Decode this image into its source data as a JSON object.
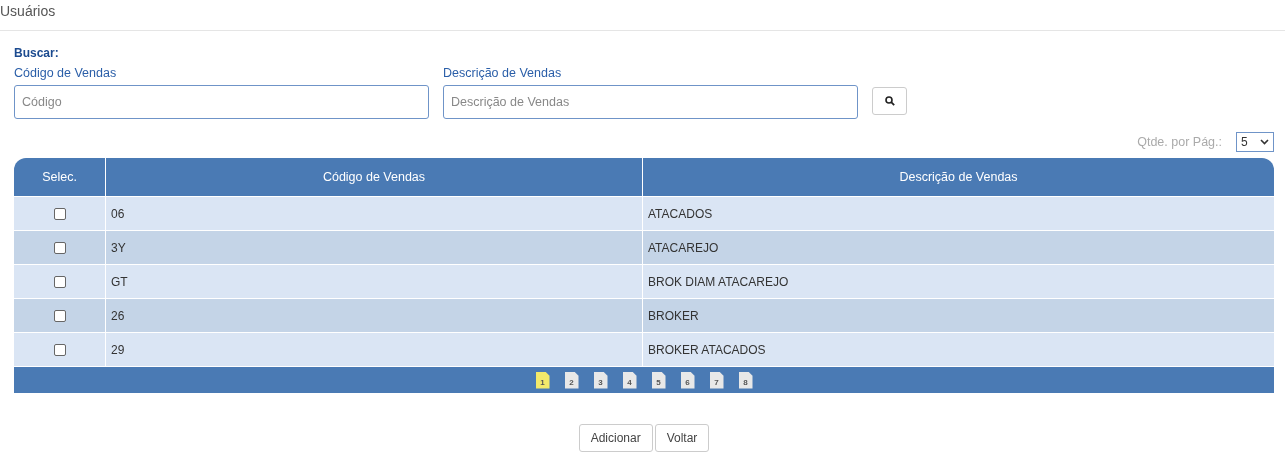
{
  "page_title": "Usuários",
  "search": {
    "heading": "Buscar:",
    "fields": [
      {
        "label": "Código de Vendas",
        "placeholder": "Código"
      },
      {
        "label": "Descrição de Vendas",
        "placeholder": "Descrição de Vendas"
      }
    ]
  },
  "page_size": {
    "label": "Qtde. por Pág.:",
    "value": "5"
  },
  "table": {
    "columns": [
      "Selec.",
      "Código de Vendas",
      "Descrição de Vendas"
    ],
    "rows": [
      {
        "checked": false,
        "code": "06",
        "description": "ATACADOS"
      },
      {
        "checked": false,
        "code": "3Y",
        "description": "ATACAREJO"
      },
      {
        "checked": false,
        "code": "GT",
        "description": "BROK DIAM ATACAREJO"
      },
      {
        "checked": false,
        "code": "26",
        "description": "BROKER"
      },
      {
        "checked": false,
        "code": "29",
        "description": "BROKER ATACADOS"
      }
    ]
  },
  "pagination": [
    {
      "label": "1",
      "selected": true
    },
    {
      "label": "2",
      "selected": false
    },
    {
      "label": "3",
      "selected": false
    },
    {
      "label": "4",
      "selected": false
    },
    {
      "label": "5",
      "selected": false
    },
    {
      "label": "6",
      "selected": false
    },
    {
      "label": "7",
      "selected": false
    },
    {
      "label": "8",
      "selected": false
    }
  ],
  "buttons": [
    "Adicionar",
    "Voltar"
  ]
}
